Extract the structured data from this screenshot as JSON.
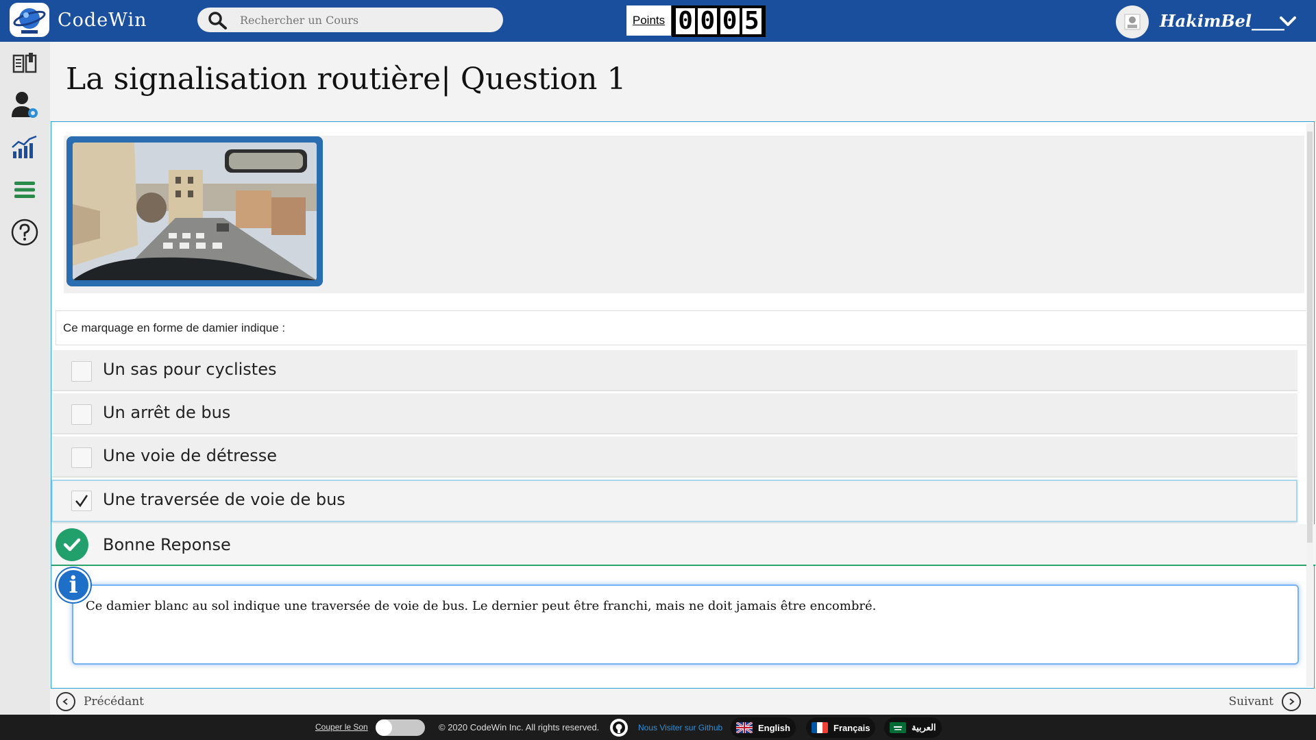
{
  "header": {
    "brand": "CodeWin",
    "search_placeholder": "Rechercher un Cours",
    "points_label": "Points",
    "points_digits": [
      "0",
      "0",
      "0",
      "5"
    ],
    "username": "HakimBel____"
  },
  "sidebar": {
    "items": [
      {
        "icon": "book-icon"
      },
      {
        "icon": "user-settings-icon"
      },
      {
        "icon": "stats-chart-icon"
      },
      {
        "icon": "menu-icon"
      },
      {
        "icon": "help-icon"
      }
    ]
  },
  "page": {
    "title": "La signalisation routière|  Question 1"
  },
  "question": {
    "prompt": "Ce marquage en forme de damier indique :",
    "options": [
      {
        "label": "Un sas pour cyclistes",
        "checked": false
      },
      {
        "label": "Un arrêt de bus",
        "checked": false
      },
      {
        "label": "Une voie de détresse",
        "checked": false
      },
      {
        "label": "Une traversée de voie de bus",
        "checked": true
      }
    ],
    "result": "Bonne Reponse",
    "explanation": "Ce damier blanc au sol indique une traversée de voie de bus. Le dernier peut être franchi, mais ne doit jamais être encombré."
  },
  "navigation": {
    "prev": "Précédant",
    "next": "Suivant"
  },
  "footer": {
    "mute": "Couper le Son",
    "copyright": "© 2020 CodeWin Inc. All rights reserved.",
    "github": "Nous Visiter sur Github",
    "languages": {
      "english": "English",
      "french": "Français",
      "arabic": "العربية"
    }
  },
  "colors": {
    "header_bg": "#1a4f9e",
    "success": "#22a06b",
    "info": "#1e6fc8",
    "accent_border": "#2a9fd6"
  }
}
